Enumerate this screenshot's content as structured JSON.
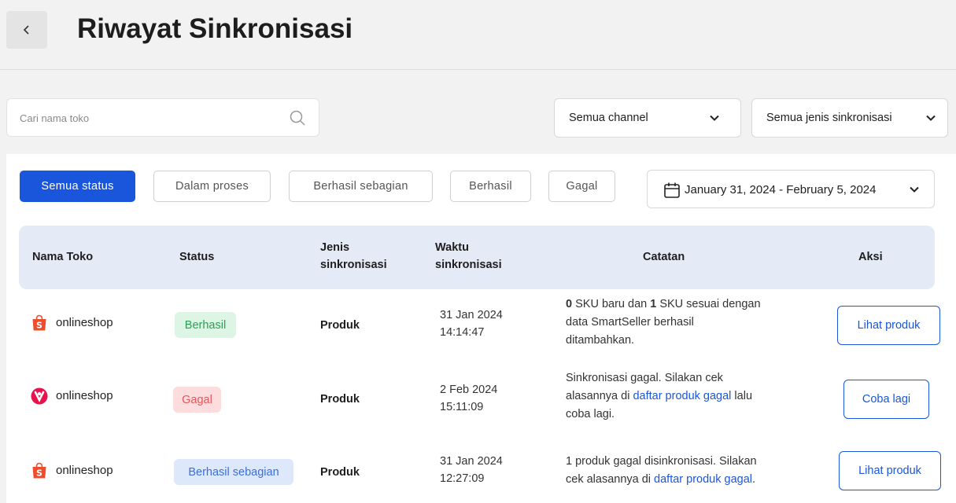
{
  "header": {
    "title": "Riwayat Sinkronisasi",
    "back_icon": "chevron-left-icon"
  },
  "search": {
    "placeholder": "Cari nama toko",
    "value": "",
    "icon": "search-icon"
  },
  "filters": {
    "channel": {
      "selected": "Semua channel",
      "icon": "chevron-down-icon"
    },
    "sync_type": {
      "selected": "Semua jenis sinkronisasi",
      "icon": "chevron-down-icon"
    },
    "status_tabs": [
      "Semua status",
      "Dalam proses",
      "Berhasil sebagian",
      "Berhasil",
      "Gagal"
    ],
    "active_status": "Semua status",
    "date_range": {
      "label": "January 31, 2024 - February 5, 2024",
      "icon": "calendar-icon"
    }
  },
  "table": {
    "headers": {
      "shop": "Nama Toko",
      "status": "Status",
      "type_line1": "Jenis",
      "type_line2": "sinkronisasi",
      "time_line1": "Waktu",
      "time_line2": "sinkronisasi",
      "note": "Catatan",
      "action": "Aksi"
    },
    "rows": [
      {
        "shop": "onlineshop",
        "shop_icon": "shopee-logo-icon",
        "status": "Berhasil",
        "type": "Produk",
        "date": "31 Jan 2024",
        "time": "14:14:47",
        "note": {
          "n1": "0",
          "t1": " SKU baru dan ",
          "n2": "1",
          "t2": " SKU sesuai dengan",
          "line2": "data SmartSeller berhasil",
          "line3": "ditambahkan."
        },
        "action": "Lihat produk"
      },
      {
        "shop": "onlineshop",
        "shop_icon": "lazada-logo-icon",
        "status": "Gagal",
        "type": "Produk",
        "date": "2 Feb 2024",
        "time": "15:11:09",
        "note": {
          "line1": "Sinkronisasi gagal. Silakan cek",
          "pre": "alasannya di ",
          "link": "daftar produk gagal",
          "post": " lalu",
          "line3": "coba lagi."
        },
        "action": "Coba lagi"
      },
      {
        "shop": "onlineshop",
        "shop_icon": "shopee-logo-icon",
        "status": "Berhasil sebagian",
        "type": "Produk",
        "date": "31 Jan 2024",
        "time": "12:27:09",
        "note": {
          "line1": "1 produk gagal disinkronisasi. Silakan",
          "pre": "cek alasannya di ",
          "link": "daftar produk gagal",
          "post": "."
        },
        "action": "Lihat produk"
      }
    ]
  },
  "colors": {
    "primary": "#1a56db",
    "success": "#2e9e55",
    "danger": "#e0575d",
    "shopee": "#ee4d2d",
    "lazada": "#e8134d"
  }
}
